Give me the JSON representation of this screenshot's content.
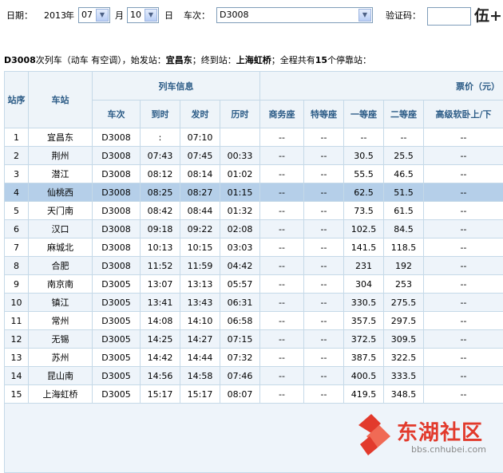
{
  "form": {
    "date_label": "日期：",
    "year": "2013",
    "year_unit": "年",
    "month": "07",
    "month_unit": "月",
    "day": "10",
    "day_unit": "日",
    "train_label": "车次：",
    "train_value": "D3008",
    "captcha_label": "验证码：",
    "captcha_value": "",
    "captcha_text": "伍+"
  },
  "summary": {
    "train": "D3008",
    "t1": "次列车（",
    "type": "动车 有空调",
    "t2": "），始发站：",
    "start": "宜昌东",
    "t3": "；终到站：",
    "end": "上海虹桥",
    "t4": "；全程共有",
    "count": "15",
    "t5": "个停靠站："
  },
  "headers": {
    "seq": "站序",
    "station": "车站",
    "train_info": "列车信息",
    "price": "票价（元）",
    "train_no": "车次",
    "arrive": "到时",
    "depart": "发时",
    "duration": "历时",
    "business": "商务座",
    "special": "特等座",
    "first": "一等座",
    "second": "二等座",
    "soft_sleeper": "高级软卧上/下"
  },
  "rows": [
    [
      "1",
      "宜昌东",
      "D3008",
      ":",
      "07:10",
      "",
      "--",
      "--",
      "--",
      "--",
      "--"
    ],
    [
      "2",
      "荆州",
      "D3008",
      "07:43",
      "07:45",
      "00:33",
      "--",
      "--",
      "30.5",
      "25.5",
      "--"
    ],
    [
      "3",
      "潜江",
      "D3008",
      "08:12",
      "08:14",
      "01:02",
      "--",
      "--",
      "55.5",
      "46.5",
      "--"
    ],
    [
      "4",
      "仙桃西",
      "D3008",
      "08:25",
      "08:27",
      "01:15",
      "--",
      "--",
      "62.5",
      "51.5",
      "--"
    ],
    [
      "5",
      "天门南",
      "D3008",
      "08:42",
      "08:44",
      "01:32",
      "--",
      "--",
      "73.5",
      "61.5",
      "--"
    ],
    [
      "6",
      "汉口",
      "D3008",
      "09:18",
      "09:22",
      "02:08",
      "--",
      "--",
      "102.5",
      "84.5",
      "--"
    ],
    [
      "7",
      "麻城北",
      "D3008",
      "10:13",
      "10:15",
      "03:03",
      "--",
      "--",
      "141.5",
      "118.5",
      "--"
    ],
    [
      "8",
      "合肥",
      "D3008",
      "11:52",
      "11:59",
      "04:42",
      "--",
      "--",
      "231",
      "192",
      "--"
    ],
    [
      "9",
      "南京南",
      "D3005",
      "13:07",
      "13:13",
      "05:57",
      "--",
      "--",
      "304",
      "253",
      "--"
    ],
    [
      "10",
      "镇江",
      "D3005",
      "13:41",
      "13:43",
      "06:31",
      "--",
      "--",
      "330.5",
      "275.5",
      "--"
    ],
    [
      "11",
      "常州",
      "D3005",
      "14:08",
      "14:10",
      "06:58",
      "--",
      "--",
      "357.5",
      "297.5",
      "--"
    ],
    [
      "12",
      "无锡",
      "D3005",
      "14:25",
      "14:27",
      "07:15",
      "--",
      "--",
      "372.5",
      "309.5",
      "--"
    ],
    [
      "13",
      "苏州",
      "D3005",
      "14:42",
      "14:44",
      "07:32",
      "--",
      "--",
      "387.5",
      "322.5",
      "--"
    ],
    [
      "14",
      "昆山南",
      "D3005",
      "14:56",
      "14:58",
      "07:46",
      "--",
      "--",
      "400.5",
      "333.5",
      "--"
    ],
    [
      "15",
      "上海虹桥",
      "D3005",
      "15:17",
      "15:17",
      "08:07",
      "--",
      "--",
      "419.5",
      "348.5",
      "--"
    ]
  ],
  "highlight_row": 3,
  "watermark": {
    "text": "东湖社区",
    "url": "bbs.cnhubei.com"
  },
  "colors": {
    "header_text": "#2b5b86",
    "highlight": "#b5cfe9",
    "watermark": "#e23a2c"
  }
}
